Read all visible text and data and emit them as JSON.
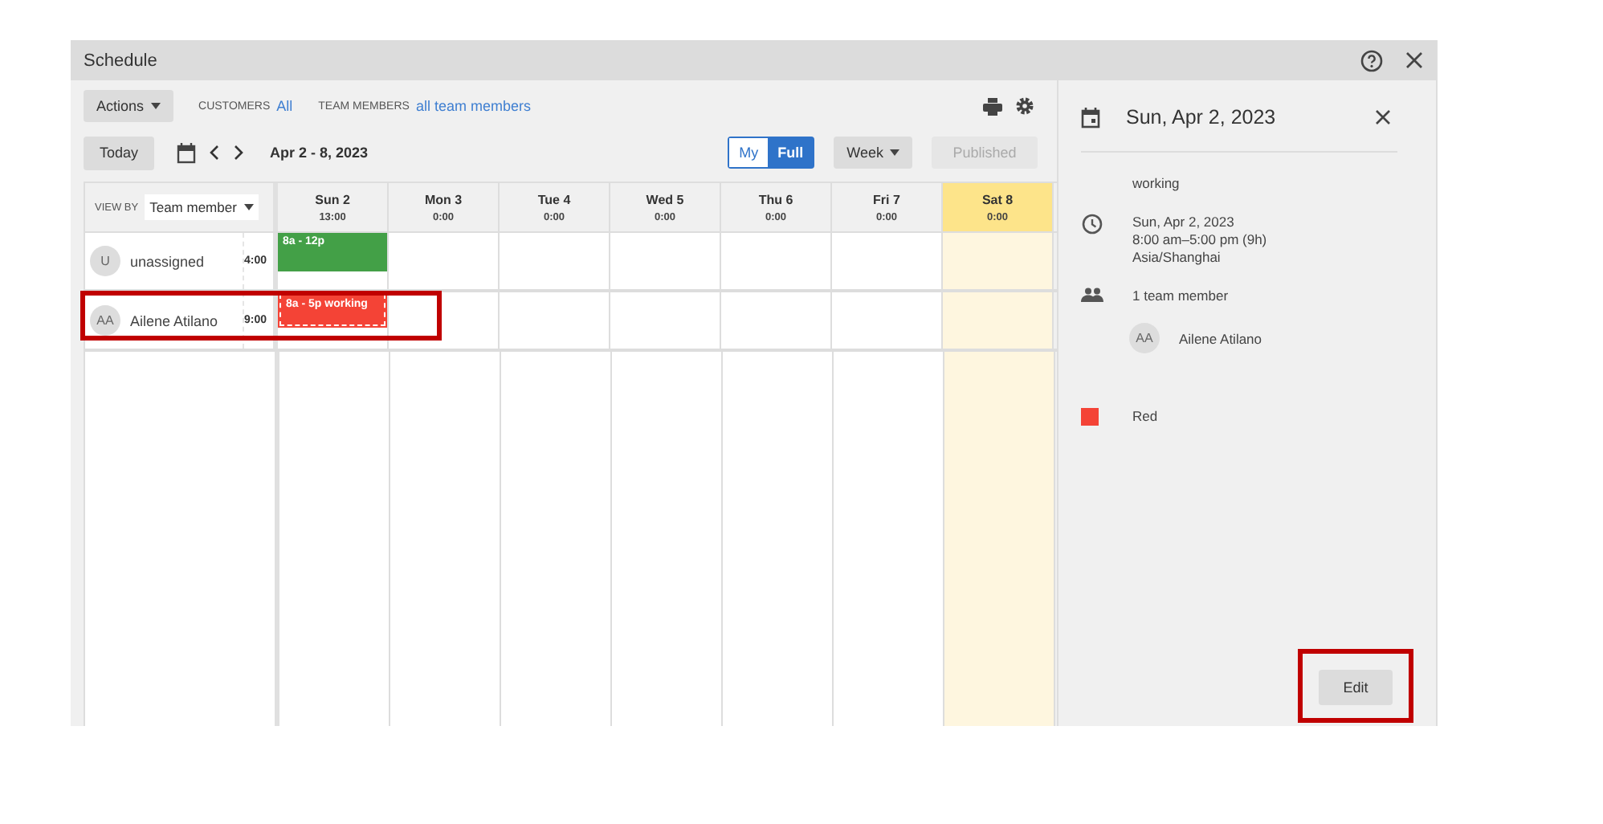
{
  "window": {
    "title": "Schedule"
  },
  "toolbar": {
    "actions": "Actions",
    "filters": [
      {
        "label": "CUSTOMERS",
        "value": "All"
      },
      {
        "label": "TEAM MEMBERS",
        "value": "all team members"
      }
    ]
  },
  "nav": {
    "today": "Today",
    "range": "Apr 2 - 8, 2023",
    "scope": [
      {
        "label": "My",
        "selected": false
      },
      {
        "label": "Full",
        "selected": true
      }
    ],
    "period": "Week",
    "publish": {
      "label": "Published",
      "disabled": true
    }
  },
  "grid": {
    "view_by_label": "VIEW BY",
    "view_by": "Team member",
    "days": [
      {
        "name": "Sun 2",
        "hours": "13:00",
        "highlighted": false
      },
      {
        "name": "Mon 3",
        "hours": "0:00",
        "highlighted": false
      },
      {
        "name": "Tue 4",
        "hours": "0:00",
        "highlighted": false
      },
      {
        "name": "Wed 5",
        "hours": "0:00",
        "highlighted": false
      },
      {
        "name": "Thu 6",
        "hours": "0:00",
        "highlighted": false
      },
      {
        "name": "Fri 7",
        "hours": "0:00",
        "highlighted": false
      },
      {
        "name": "Sat 8",
        "hours": "0:00",
        "highlighted": true
      }
    ],
    "members": [
      {
        "initials": "U",
        "name": "unassigned",
        "hours": "4:00",
        "marked": false,
        "shifts": [
          {
            "label": "8a - 12p",
            "color": "#43a047",
            "selected": false
          }
        ]
      },
      {
        "initials": "AA",
        "name": "Ailene Atilano",
        "hours": "9:00",
        "marked": true,
        "shifts": [
          {
            "label": "8a - 5p working",
            "color": "#f44336",
            "selected": true
          }
        ]
      }
    ]
  },
  "detail": {
    "date": "Sun, Apr 2, 2023",
    "title": "working",
    "when": [
      "Sun, Apr 2, 2023",
      "8:00 am–5:00 pm (9h)",
      "Asia/Shanghai"
    ],
    "member_count": "1 team member",
    "members": [
      {
        "initials": "AA",
        "name": "Ailene Atilano"
      }
    ],
    "color": {
      "name": "Red",
      "color": "#f44336"
    },
    "edit": {
      "label": "Edit",
      "marked": true
    }
  }
}
